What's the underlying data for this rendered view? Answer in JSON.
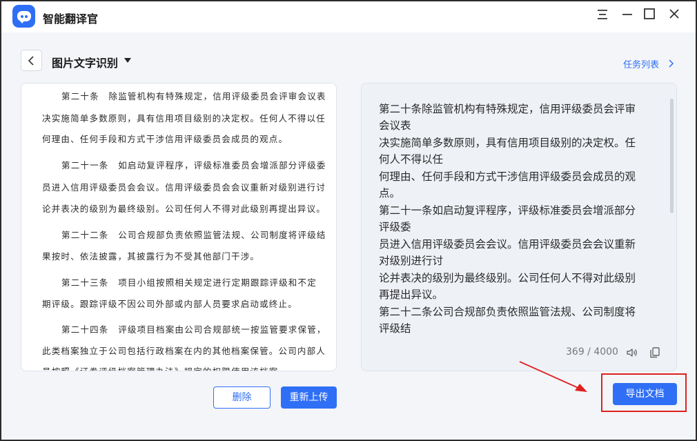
{
  "app": {
    "title": "智能翻译官"
  },
  "header": {
    "title": "图片文字识别",
    "task_link": "任务列表"
  },
  "image_doc": {
    "lines": [
      "第二十条　除监管机构有特殊规定，信用评级委员会评审会议表",
      "决实施简单多数原则，具有信用项目级别的决定权。任何人不得以任",
      "何理由、任何手段和方式干涉信用评级委员会成员的观点。",
      "第二十一条　如启动复评程序，评级标准委员会增派部分评级委",
      "员进入信用评级委员会会议。信用评级委员会会议重新对级别进行讨",
      "论并表决的级别为最终级别。公司任何人不得对此级别再提出异议。",
      "第二十二条　公司合规部负责依照监管法规、公司制度将评级结",
      "果按时、依法披露，其披露行为不受其他部门干涉。",
      "第二十三条　项目小组按照相关规定进行定期跟踪评级和不定",
      "期评级。跟踪评级不因公司外部或内部人员要求启动或终止。",
      "第二十四条　评级项目档案由公司合规部统一按监管要求保管，",
      "此类档案独立于公司包括行政档案在内的其他档案保管。公司内部人",
      "员按照《证券评级档案管理办法》规定的权限使用该档案"
    ]
  },
  "ocr_result": {
    "lines": [
      "第二十条除监管机构有特殊规定，信用评级委员会评审",
      "会议表",
      "决实施简单多数原则，具有信用项目级别的决定权。任",
      "何人不得以任",
      "何理由、任何手段和方式干涉信用评级委员会成员的观",
      "点。",
      "第二十一条如启动复评程序，评级标准委员会增派部分",
      "评级委",
      "员进入信用评级委员会会议。信用评级委员会会议重新",
      "对级别进行讨",
      "论并表决的级别为最终级别。公司任何人不得对此级别",
      "再提出异议。",
      "第二十二条公司合规部负责依照监管法规、公司制度将",
      "评级结"
    ],
    "char_count": "369 / 4000"
  },
  "buttons": {
    "delete": "删除",
    "reupload": "重新上传",
    "export": "导出文档"
  },
  "colors": {
    "accent": "#2f6ff5",
    "annotation": "#e02020"
  }
}
